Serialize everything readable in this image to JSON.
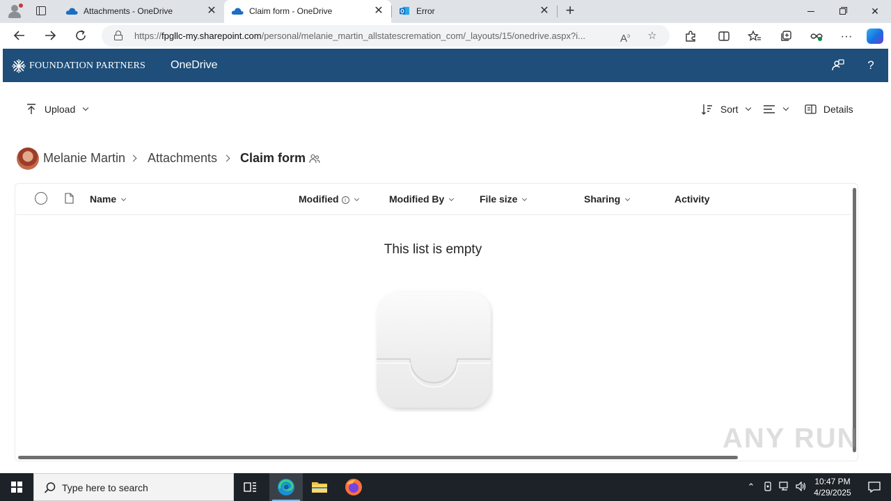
{
  "browser": {
    "tabs": [
      {
        "title": "Attachments - OneDrive",
        "icon": "onedrive-cloud-icon",
        "active": false
      },
      {
        "title": "Claim form - OneDrive",
        "icon": "onedrive-cloud-icon",
        "active": true
      },
      {
        "title": "Error",
        "icon": "outlook-icon",
        "active": false
      }
    ],
    "url_prefix": "https://",
    "url_host": "fpgllc-my.sharepoint.com",
    "url_path": "/personal/melanie_martin_allstatescremation_com/_layouts/15/onedrive.aspx?i..."
  },
  "header": {
    "brand": "FOUNDATION PARTNERS",
    "app_name": "OneDrive",
    "bg_color": "#1e4e79"
  },
  "commandbar": {
    "upload": "Upload",
    "sort": "Sort",
    "details": "Details"
  },
  "breadcrumb": {
    "owner": "Melanie Martin",
    "parent": "Attachments",
    "current": "Claim form"
  },
  "list": {
    "columns": [
      "Name",
      "Modified",
      "Modified By",
      "File size",
      "Sharing",
      "Activity"
    ],
    "empty_message": "This list is empty"
  },
  "taskbar": {
    "search_placeholder": "Type here to search",
    "time": "10:47 PM",
    "date": "4/29/2025"
  },
  "watermark": "ANY RUN"
}
